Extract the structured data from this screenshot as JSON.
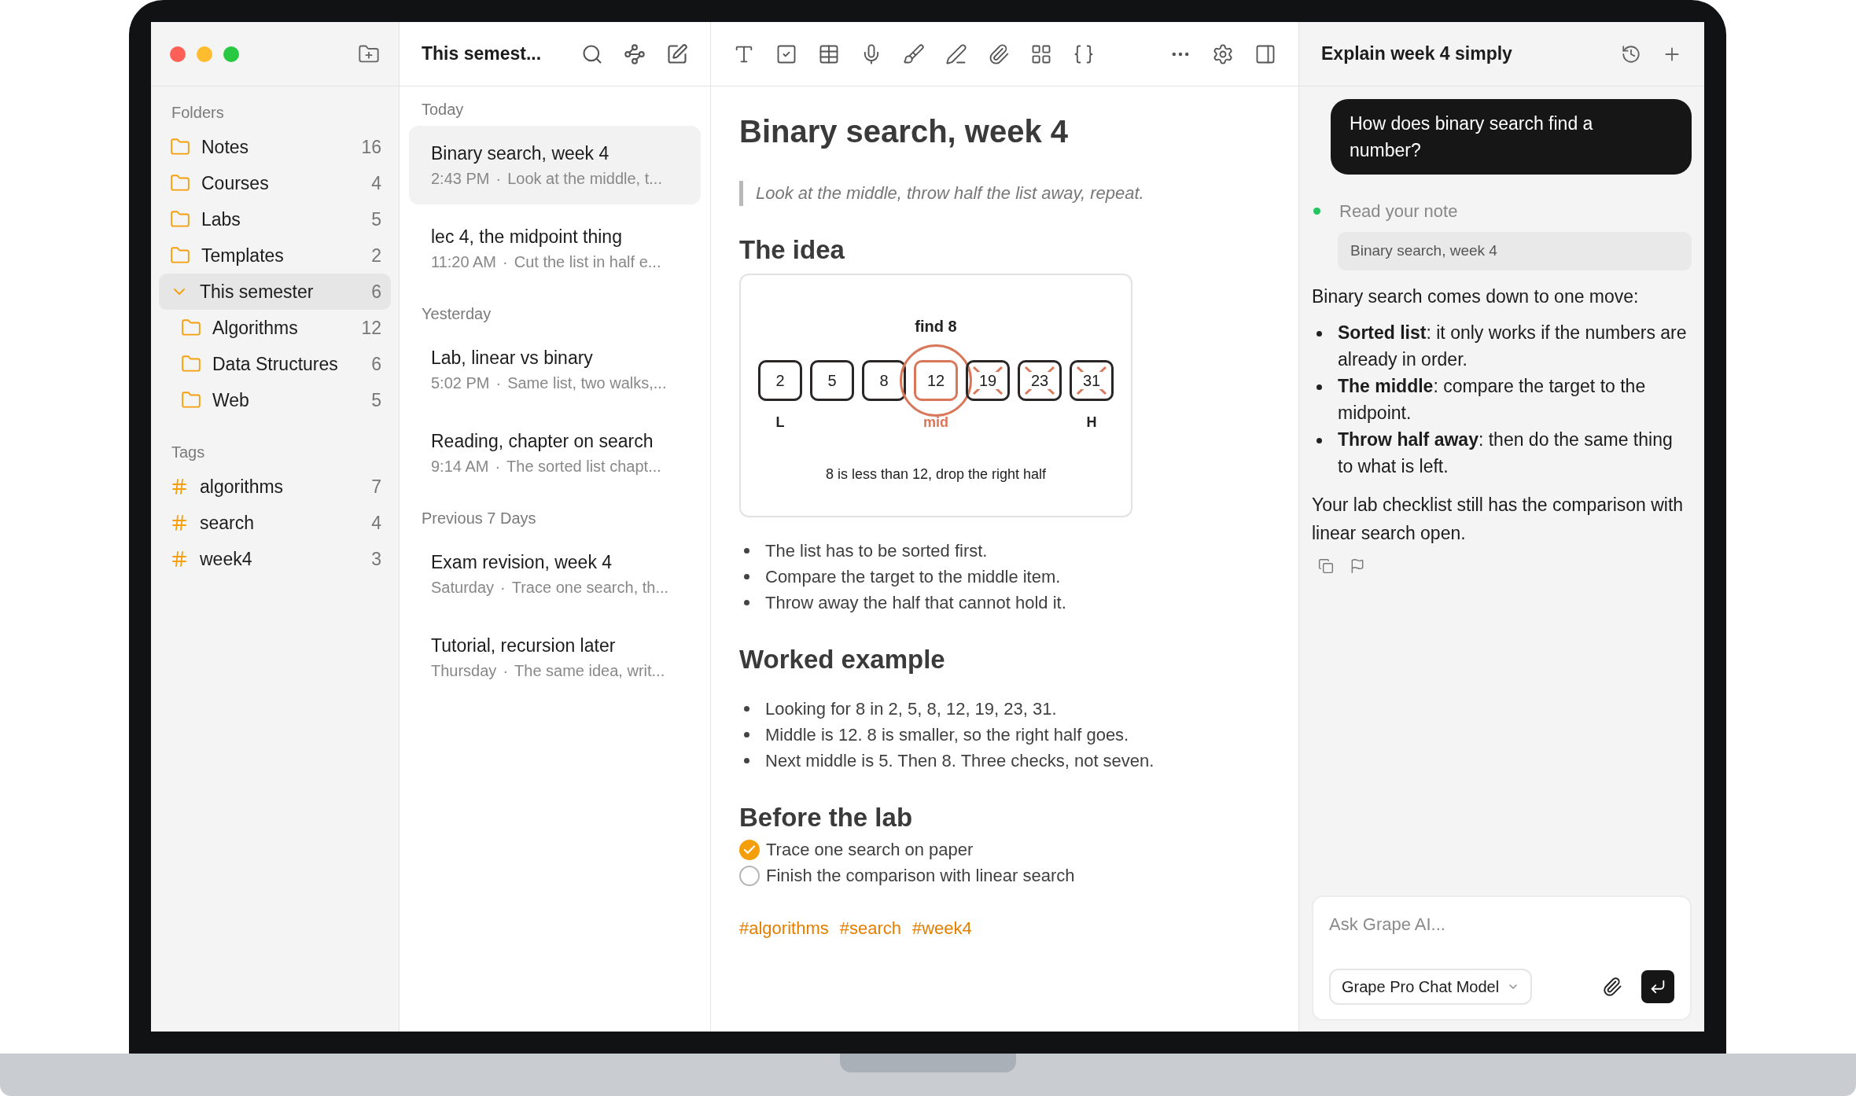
{
  "sidebar": {
    "sections": [
      {
        "label": "Folders",
        "kind": "folder",
        "items": [
          {
            "label": "Notes",
            "count": "16",
            "selected": false,
            "expanded": false
          },
          {
            "label": "Courses",
            "count": "4",
            "selected": false,
            "expanded": false
          },
          {
            "label": "Labs",
            "count": "5",
            "selected": false,
            "expanded": false
          },
          {
            "label": "Templates",
            "count": "2",
            "selected": false,
            "expanded": false
          },
          {
            "label": "This semester",
            "count": "6",
            "selected": true,
            "expanded": true,
            "children": [
              {
                "label": "Algorithms",
                "count": "12",
                "selected": false,
                "expanded": false
              },
              {
                "label": "Data Structures",
                "count": "6",
                "selected": false,
                "expanded": false
              },
              {
                "label": "Web",
                "count": "5",
                "selected": false,
                "expanded": false
              }
            ]
          }
        ]
      },
      {
        "label": "Tags",
        "kind": "tag",
        "items": [
          {
            "label": "algorithms",
            "count": "7",
            "selected": false
          },
          {
            "label": "search",
            "count": "4",
            "selected": false
          },
          {
            "label": "week4",
            "count": "3",
            "selected": false
          }
        ]
      }
    ]
  },
  "note_list": {
    "title": "This semest...",
    "separator": "·",
    "groups": [
      {
        "label": "Today",
        "notes": [
          {
            "title": "Binary search, week 4",
            "time": "2:43 PM",
            "preview": "Look at the middle, t...",
            "selected": true
          },
          {
            "title": "lec 4, the midpoint thing",
            "time": "11:20 AM",
            "preview": "Cut the list in half e...",
            "selected": false
          }
        ]
      },
      {
        "label": "Yesterday",
        "notes": [
          {
            "title": "Lab, linear vs binary",
            "time": "5:02 PM",
            "preview": "Same list, two walks,...",
            "selected": false
          },
          {
            "title": "Reading, chapter on search",
            "time": "9:14 AM",
            "preview": "The sorted list chapt...",
            "selected": false
          }
        ]
      },
      {
        "label": "Previous 7 Days",
        "notes": [
          {
            "title": "Exam revision, week 4",
            "time": "Saturday",
            "preview": "Trace one search, th...",
            "selected": false
          },
          {
            "title": "Tutorial, recursion later",
            "time": "Thursday",
            "preview": "The same idea, writ...",
            "selected": false
          }
        ]
      }
    ]
  },
  "editor": {
    "title": "Binary search, week 4",
    "quote": "Look at the middle, throw half the list away, repeat.",
    "blocks": [
      {
        "kind": "heading",
        "text": "The idea"
      },
      {
        "kind": "diagram",
        "label": "find 8",
        "caption": "8 is less than 12, drop the right half",
        "cells": [
          {
            "value": "2",
            "kind": "plain",
            "pointer": "L"
          },
          {
            "value": "5",
            "kind": "plain"
          },
          {
            "value": "8",
            "kind": "plain"
          },
          {
            "value": "12",
            "kind": "mid",
            "pointer": "mid"
          },
          {
            "value": "19",
            "kind": "dropped"
          },
          {
            "value": "23",
            "kind": "dropped"
          },
          {
            "value": "31",
            "kind": "dropped",
            "pointer": "H"
          }
        ]
      },
      {
        "kind": "bullets",
        "items": [
          "The list has to be sorted first.",
          "Compare the target to the middle item.",
          "Throw away the half that cannot hold it."
        ]
      },
      {
        "kind": "heading",
        "text": "Worked example"
      },
      {
        "kind": "bullets",
        "items": [
          "Looking for 8 in 2, 5, 8, 12, 19, 23, 31.",
          "Middle is 12. 8 is smaller, so the right half goes.",
          "Next middle is 5. Then 8. Three checks, not seven."
        ]
      },
      {
        "kind": "heading",
        "text": "Before the lab"
      },
      {
        "kind": "checklist",
        "items": [
          {
            "text": "Trace one search on paper",
            "checked": true
          },
          {
            "text": "Finish the comparison with linear search",
            "checked": false
          }
        ]
      },
      {
        "kind": "tags",
        "items": [
          "#algorithms",
          "#search",
          "#week4"
        ]
      }
    ]
  },
  "assistant": {
    "title": "Explain week 4 simply",
    "question": "How does binary search find a number?",
    "step": {
      "label": "Read your note",
      "color": "#22c55e",
      "chip": "Binary search, week 4"
    },
    "intro": "Binary search comes down to one move:",
    "points": [
      "**Sorted list**: it only works if the numbers are already in order.",
      "**The middle**: compare the target to the midpoint.",
      "**Throw half away**: then do the same thing to what is left."
    ],
    "outro": "Your lab checklist still has the comparison with linear search open.",
    "input": {
      "placeholder": "Ask Grape AI...",
      "model": "Grape Pro Chat Model"
    }
  }
}
